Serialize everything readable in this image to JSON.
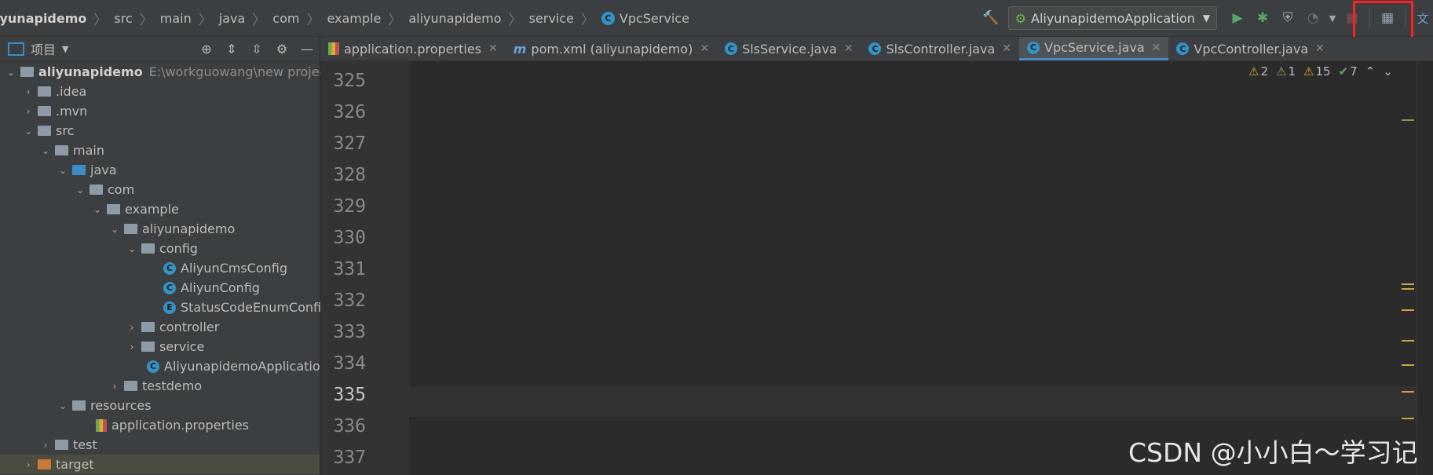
{
  "breadcrumb": [
    "iyunapidemo",
    "src",
    "main",
    "java",
    "com",
    "example",
    "aliyunapidemo",
    "service",
    "VpcService"
  ],
  "toolbar": {
    "run_config": "AliyunapidemoApplication"
  },
  "project_panel": {
    "title": "项目"
  },
  "tree": [
    {
      "label": "aliyunapidemo",
      "path": "E:\\workguowang\\new project\\ali"
    },
    {
      "label": ".idea"
    },
    {
      "label": ".mvn"
    },
    {
      "label": "src"
    },
    {
      "label": "main"
    },
    {
      "label": "java"
    },
    {
      "label": "com"
    },
    {
      "label": "example"
    },
    {
      "label": "aliyunapidemo"
    },
    {
      "label": "config"
    },
    {
      "label": "AliyunCmsConfig"
    },
    {
      "label": "AliyunConfig"
    },
    {
      "label": "StatusCodeEnumConfig"
    },
    {
      "label": "controller"
    },
    {
      "label": "service"
    },
    {
      "label": "AliyunapidemoApplication"
    },
    {
      "label": "testdemo"
    },
    {
      "label": "resources"
    },
    {
      "label": "application.properties"
    },
    {
      "label": "test"
    },
    {
      "label": "target"
    }
  ],
  "tabs": [
    {
      "label": "application.properties"
    },
    {
      "label": "pom.xml (aliyunapidemo)"
    },
    {
      "label": "SlsService.java"
    },
    {
      "label": "SlsController.java"
    },
    {
      "label": "VpcService.java"
    },
    {
      "label": "VpcController.java"
    }
  ],
  "line_numbers": [
    "325",
    "326",
    "327",
    "328",
    "329",
    "330",
    "331",
    "332",
    "333",
    "334",
    "335",
    "336",
    "337"
  ],
  "inspections": {
    "errors": "2",
    "warnings": "1",
    "weak": "15",
    "ok": "7"
  },
  "watermark": "CSDN @小小白～学习记",
  "colors": {
    "accent": "#4a88c7",
    "highlight": "#ff2020"
  }
}
